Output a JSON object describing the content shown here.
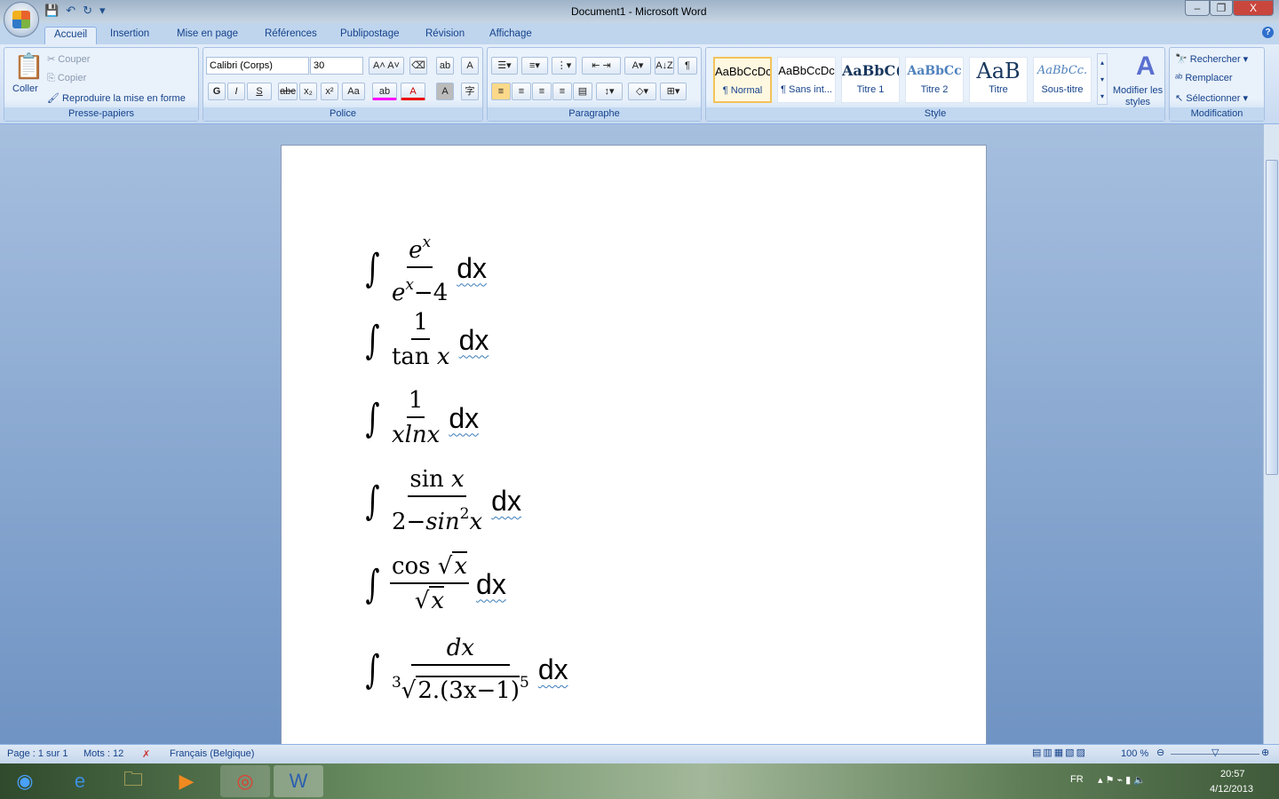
{
  "window": {
    "title": "Document1 - Microsoft Word",
    "min": "–",
    "max": "❐",
    "close": "X"
  },
  "tabs": [
    "Accueil",
    "Insertion",
    "Mise en page",
    "Références",
    "Publipostage",
    "Révision",
    "Affichage"
  ],
  "clipboard": {
    "paste": "Coller",
    "cut": "Couper",
    "copy": "Copier",
    "format_painter": "Reproduire la mise en forme",
    "label": "Presse-papiers"
  },
  "font": {
    "name": "Calibri (Corps)",
    "size": "30",
    "label": "Police",
    "bold": "G",
    "italic": "I",
    "underline": "S",
    "strike": "abc",
    "sub": "x₂",
    "sup": "x²",
    "case": "Aa",
    "grow": "A˄",
    "shrink": "A˅",
    "color": "A",
    "shade": "A",
    "enclose": "字"
  },
  "paragraph": {
    "label": "Paragraphe",
    "sort": "A↓Z",
    "pilcrow": "¶"
  },
  "styles": {
    "label": "Style",
    "items": [
      {
        "preview": "AaBbCcDc",
        "name": "¶ Normal"
      },
      {
        "preview": "AaBbCcDc",
        "name": "¶ Sans int..."
      },
      {
        "preview": "AaBbC(",
        "name": "Titre 1"
      },
      {
        "preview": "AaBbCc",
        "name": "Titre 2"
      },
      {
        "preview": "AaB",
        "name": "Titre"
      },
      {
        "preview": "AaBbCc.",
        "name": "Sous-titre"
      }
    ],
    "change": "Modifier les styles"
  },
  "editing": {
    "label": "Modification",
    "find": "Rechercher",
    "replace": "Remplacer",
    "select": "Sélectionner"
  },
  "equations": [
    {
      "num": [
        "e",
        "x"
      ],
      "den": [
        "e",
        "x",
        "−4"
      ]
    },
    {
      "num": "1",
      "den": [
        "tan ",
        "x"
      ]
    },
    {
      "num": "1",
      "den": "xlnx"
    },
    {
      "num": [
        "sin ",
        "x"
      ],
      "den": [
        "2−",
        "sin",
        "2",
        "x"
      ]
    },
    {
      "num": [
        "cos ",
        "x"
      ],
      "den": "x"
    },
    {
      "num": "dx",
      "den": [
        "3",
        "2.(3x−1)",
        "5"
      ]
    }
  ],
  "dx": "dx",
  "status": {
    "page": "Page : 1 sur 1",
    "words": "Mots : 12",
    "language": "Français (Belgique)",
    "zoom": "100 %"
  },
  "tray": {
    "lang": "FR",
    "time": "20:57",
    "date": "4/12/2013"
  },
  "zoom_percent": 100
}
